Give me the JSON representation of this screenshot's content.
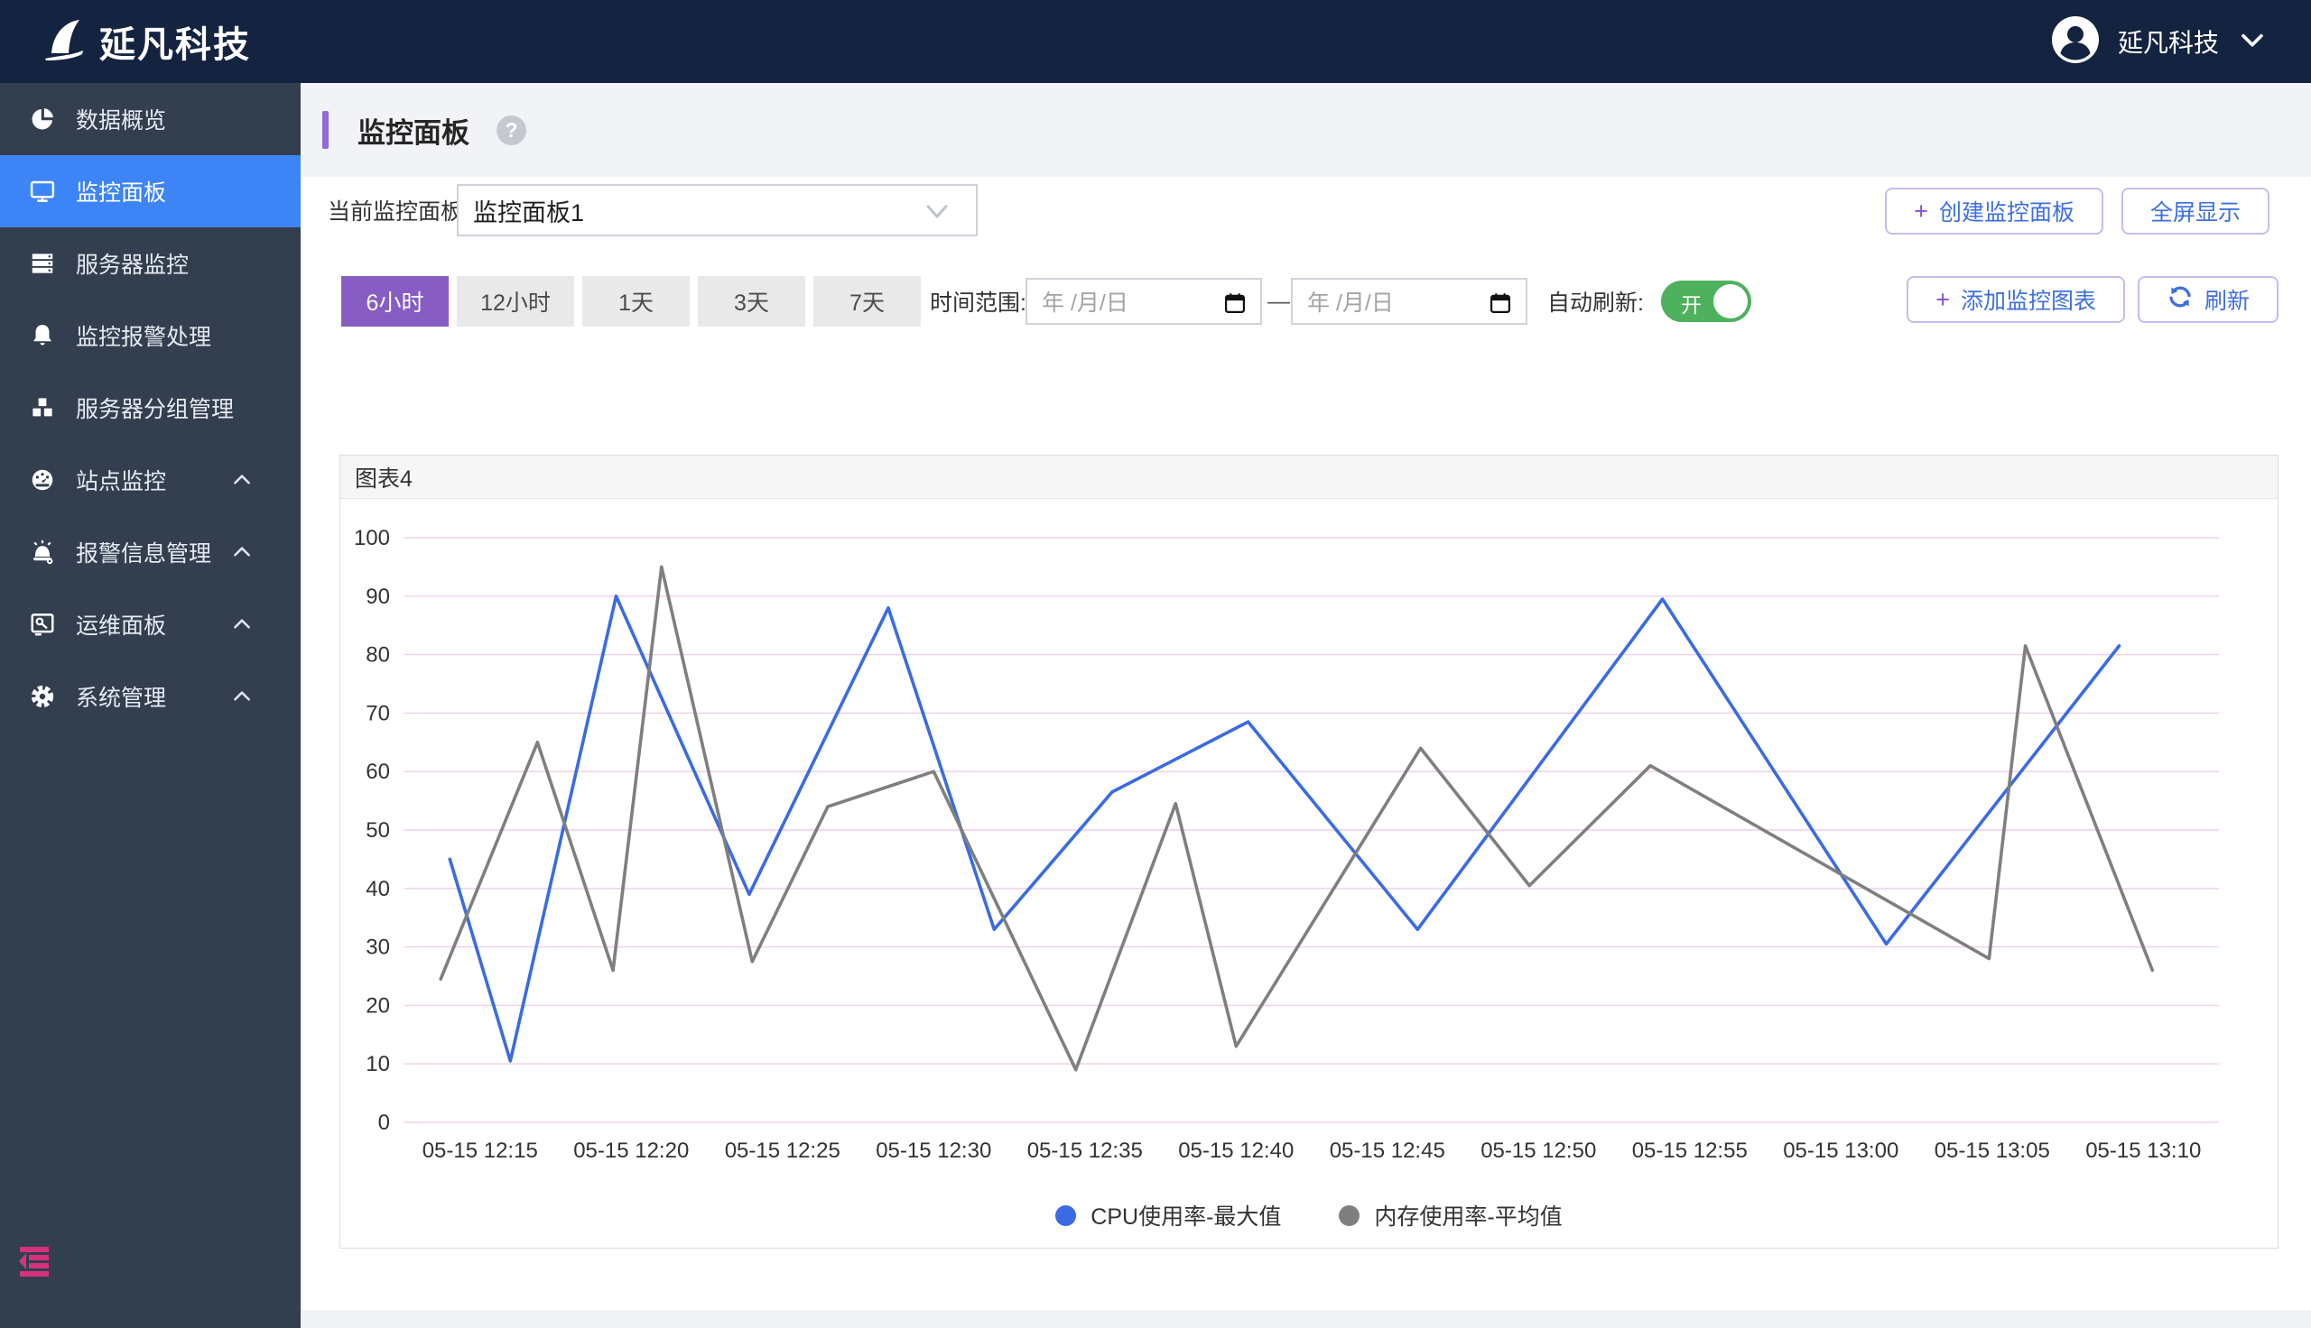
{
  "topbar": {
    "brand": "延凡科技",
    "user_name": "延凡科技"
  },
  "sidebar": {
    "items": [
      {
        "label": "数据概览",
        "icon": "pie-chart-icon",
        "active": false,
        "expandable": false
      },
      {
        "label": "监控面板",
        "icon": "monitor-icon",
        "active": true,
        "expandable": false
      },
      {
        "label": "服务器监控",
        "icon": "server-icon",
        "active": false,
        "expandable": false
      },
      {
        "label": "监控报警处理",
        "icon": "bell-icon",
        "active": false,
        "expandable": false
      },
      {
        "label": "服务器分组管理",
        "icon": "cubes-icon",
        "active": false,
        "expandable": false
      },
      {
        "label": "站点监控",
        "icon": "gauge-icon",
        "active": false,
        "expandable": true
      },
      {
        "label": "报警信息管理",
        "icon": "alarm-icon",
        "active": false,
        "expandable": true
      },
      {
        "label": "运维面板",
        "icon": "ops-panel-icon",
        "active": false,
        "expandable": true
      },
      {
        "label": "系统管理",
        "icon": "gear-icon",
        "active": false,
        "expandable": true
      }
    ]
  },
  "page": {
    "title": "监控面板"
  },
  "panel_select": {
    "label": "当前监控面板",
    "value": "监控面板1"
  },
  "actions": {
    "plus": "+",
    "create": "创建监控面板",
    "fullscreen": "全屏显示",
    "add_chart": "添加监控图表",
    "refresh": "刷新"
  },
  "toolbar": {
    "ranges": [
      {
        "label": "6小时",
        "active": true
      },
      {
        "label": "12小时",
        "active": false
      },
      {
        "label": "1天",
        "active": false
      },
      {
        "label": "3天",
        "active": false
      },
      {
        "label": "7天",
        "active": false
      }
    ],
    "time_range_label": "时间范围:",
    "date_placeholder": "年 /月/日",
    "separator": "—",
    "auto_refresh_label": "自动刷新:",
    "auto_refresh_state": "开"
  },
  "colors": {
    "accent_purple": "#875cc3",
    "link_blue": "#3d6fe0",
    "toggle_green": "#4db15d",
    "sidebar_active": "#3d84f7",
    "grid_pink": "#f2cdea"
  },
  "chart_data": {
    "type": "line",
    "title": "图表4",
    "y_axis": {
      "min": 0,
      "max": 100,
      "step": 10,
      "ticks": [
        0,
        10,
        20,
        30,
        40,
        50,
        60,
        70,
        80,
        90,
        100
      ]
    },
    "x_axis": {
      "tick_minutes": [
        15,
        20,
        25,
        30,
        35,
        40,
        45,
        50,
        55,
        60,
        65,
        70
      ],
      "tick_labels": [
        "05-15 12:15",
        "05-15 12:20",
        "05-15 12:25",
        "05-15 12:30",
        "05-15 12:35",
        "05-15 12:40",
        "05-15 12:45",
        "05-15 12:50",
        "05-15 12:55",
        "05-15 13:00",
        "05-15 13:05",
        "05-15 13:10"
      ]
    },
    "x_window_minutes": [
      12.5,
      72.5
    ],
    "grid": true,
    "legend_position": "bottom",
    "series": [
      {
        "name": "CPU使用率-最大值",
        "color": "#3a6be4",
        "points": [
          [
            14.0,
            45
          ],
          [
            16.0,
            10.5
          ],
          [
            19.5,
            90
          ],
          [
            23.9,
            39
          ],
          [
            28.5,
            88
          ],
          [
            32.0,
            33
          ],
          [
            35.9,
            56.5
          ],
          [
            40.4,
            68.5
          ],
          [
            46.0,
            33
          ],
          [
            54.1,
            89.5
          ],
          [
            61.5,
            30.5
          ],
          [
            69.2,
            81.5
          ]
        ]
      },
      {
        "name": "内存使用率-平均值",
        "color": "#7f7f7f",
        "points": [
          [
            13.7,
            24.5
          ],
          [
            16.9,
            65
          ],
          [
            19.4,
            26
          ],
          [
            21.0,
            95
          ],
          [
            24.0,
            27.5
          ],
          [
            26.5,
            54
          ],
          [
            30.0,
            60
          ],
          [
            34.7,
            9
          ],
          [
            38.0,
            54.5
          ],
          [
            40.0,
            13
          ],
          [
            46.1,
            64
          ],
          [
            49.7,
            40.5
          ],
          [
            53.7,
            61
          ],
          [
            64.9,
            28
          ],
          [
            66.1,
            81.5
          ],
          [
            70.3,
            26
          ]
        ]
      }
    ]
  }
}
